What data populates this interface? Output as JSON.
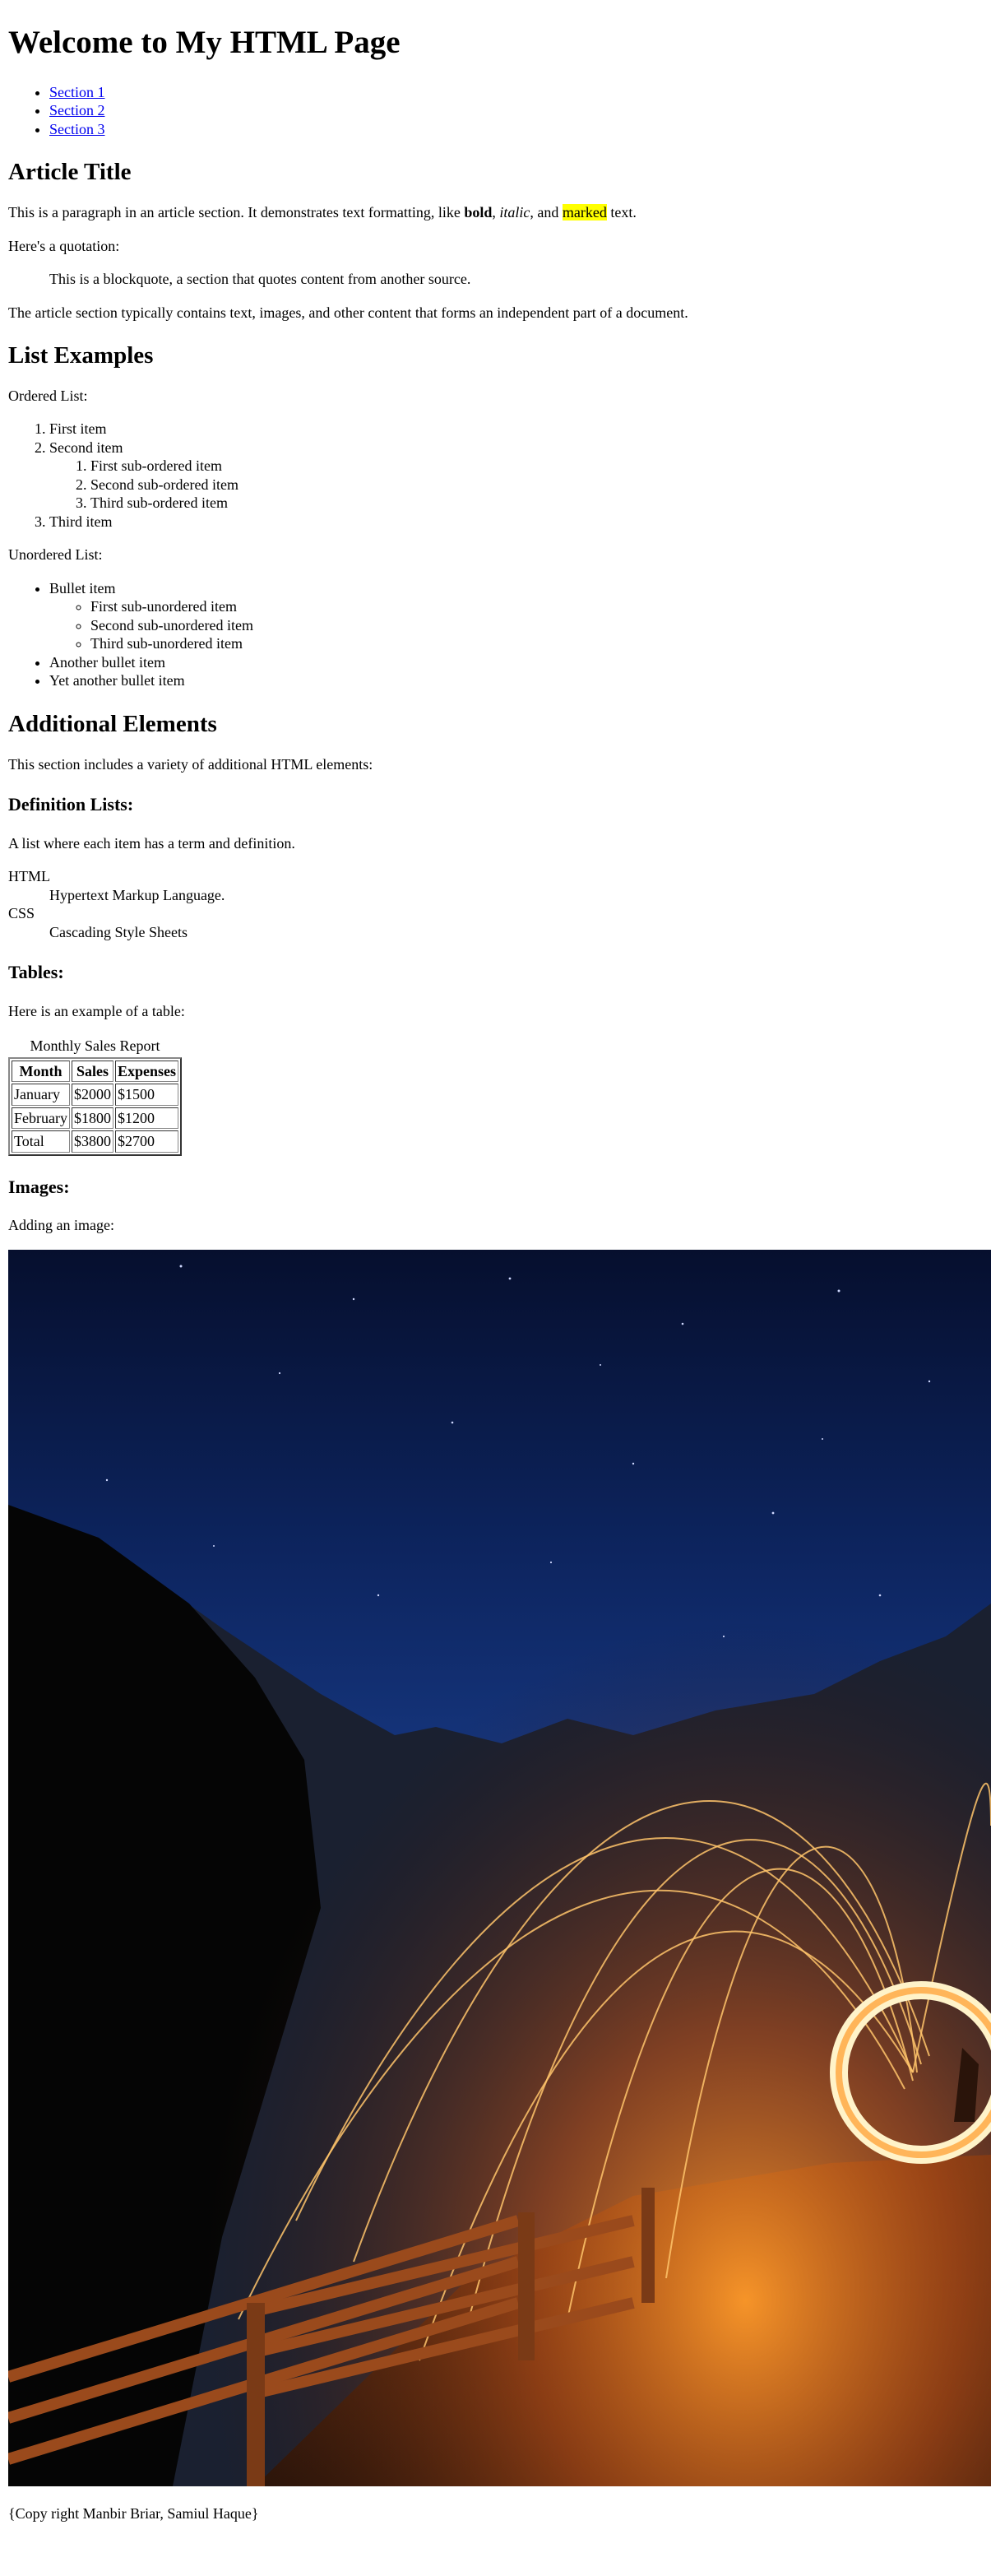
{
  "header": {
    "title": "Welcome to My HTML Page",
    "nav": [
      "Section 1",
      "Section 2",
      "Section 3"
    ]
  },
  "article": {
    "title": "Article Title",
    "p1_before": "This is a paragraph in an article section. It demonstrates text formatting, like ",
    "bold": "bold",
    "sep1": ", ",
    "italic": "italic",
    "sep2": ", and ",
    "marked": "marked",
    "p1_after": " text.",
    "quote_intro": "Here's a quotation:",
    "blockquote": "This is a blockquote, a section that quotes content from another source.",
    "p2": "The article section typically contains text, images, and other content that forms an independent part of a document."
  },
  "lists": {
    "title": "List Examples",
    "ordered_label": "Ordered List:",
    "ordered": [
      "First item",
      "Second item",
      "Third item"
    ],
    "ordered_sub": [
      "First sub-ordered item",
      "Second sub-ordered item",
      "Third sub-ordered item"
    ],
    "unordered_label": "Unordered List:",
    "unordered": [
      "Bullet item",
      "Another bullet item",
      "Yet another bullet item"
    ],
    "unordered_sub": [
      "First sub-unordered item",
      "Second sub-unordered item",
      "Third sub-unordered item"
    ]
  },
  "additional": {
    "title": "Additional Elements",
    "intro": "This section includes a variety of additional HTML elements:",
    "deflist_title": "Definition Lists:",
    "deflist_intro": "A list where each item has a term and definition.",
    "definitions": [
      {
        "term": "HTML",
        "def": "Hypertext Markup Language."
      },
      {
        "term": "CSS",
        "def": "Cascading Style Sheets"
      }
    ],
    "tables_title": "Tables:",
    "tables_intro": "Here is an example of a table:",
    "table": {
      "caption": "Monthly Sales Report",
      "headers": [
        "Month",
        "Sales",
        "Expenses"
      ],
      "rows": [
        [
          "January",
          "$2000",
          "$1500"
        ],
        [
          "February",
          "$1800",
          "$1200"
        ],
        [
          "Total",
          "$3800",
          "$2700"
        ]
      ]
    },
    "images_title": "Images:",
    "images_intro": "Adding an image:"
  },
  "footer": {
    "text": "{Copy right Manbir Briar, Samiul Haque}"
  },
  "colors": {
    "link": "#0000ee",
    "mark": "#ffff00",
    "sky_top": "#071033",
    "sky_mid": "#1b3d8a",
    "ground": "#3a1e0e",
    "sparks": "#ffb347"
  },
  "icons": {
    "bullet": "disc",
    "sub_bullet": "circle"
  }
}
